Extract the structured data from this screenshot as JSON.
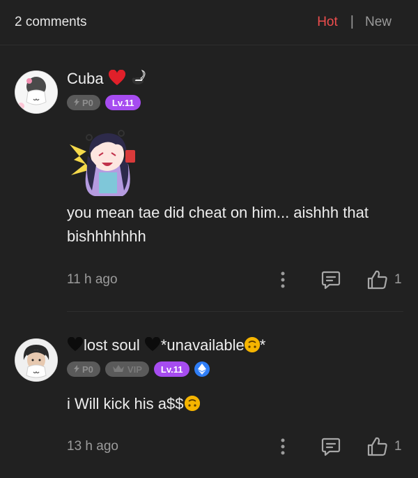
{
  "header": {
    "comment_count": "2 comments",
    "sort_hot": "Hot",
    "sort_separator": "|",
    "sort_new": "New"
  },
  "comments": [
    {
      "username": "Cuba",
      "badges": {
        "points": "P0",
        "level": "Lv.11"
      },
      "text": "you mean tae did cheat on him... aishhh that bishhhhhhh",
      "time": "11 h ago",
      "likes": "1"
    },
    {
      "username_part1": "lost soul",
      "username_part2": "*unavailable",
      "username_part3": "*",
      "badges": {
        "points": "P0",
        "vip": "VIP",
        "level": "Lv.11"
      },
      "text": "i Will kick his a$$",
      "time": "13 h ago",
      "likes": "1"
    }
  ],
  "colors": {
    "accent_hot": "#ee4d4d",
    "level_badge": "#a64cf0",
    "background": "#212121"
  }
}
